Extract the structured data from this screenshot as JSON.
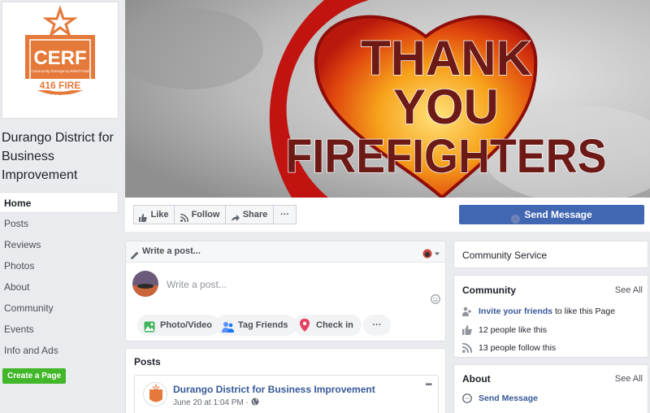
{
  "left": {
    "logo": {
      "top_text": "CERF",
      "sub_text": "Community Emergency Relief Fund",
      "band_text": "416 FIRE",
      "bottom_text": "SW COLORADO"
    },
    "page_name": "Durango District for Business Improvement",
    "nav": [
      {
        "label": "Home",
        "active": true
      },
      {
        "label": "Posts"
      },
      {
        "label": "Reviews"
      },
      {
        "label": "Photos"
      },
      {
        "label": "About"
      },
      {
        "label": "Community"
      },
      {
        "label": "Events"
      },
      {
        "label": "Info and Ads"
      }
    ],
    "create_page": "Create a Page"
  },
  "cover": {
    "line1": "THANK",
    "line2": "YOU",
    "line3": "FIREFIGHTERS"
  },
  "actions": {
    "like": "Like",
    "follow": "Follow",
    "share": "Share",
    "more": "···",
    "send_message": "Send Message"
  },
  "composer": {
    "header": "Write a post...",
    "placeholder": "Write a post...",
    "tools": [
      "Photo/Video",
      "Tag Friends",
      "Check in"
    ],
    "more": "···"
  },
  "posts": {
    "title": "Posts",
    "first": {
      "author": "Durango District for Business Improvement",
      "time": "June 20 at 1:04 PM · ",
      "more": "•••"
    }
  },
  "right": {
    "category": "Community Service",
    "community": {
      "title": "Community",
      "see_all": "See All",
      "invite_link": "Invite your friends",
      "invite_rest": " to like this Page",
      "likes": "12 people like this",
      "follows": "13 people follow this"
    },
    "about": {
      "title": "About",
      "see_all": "See All",
      "send_message": "Send Message"
    }
  },
  "colors": {
    "fb_blue": "#4267b2",
    "link": "#365899",
    "green": "#42b72a",
    "cerf_orange": "#e5793a"
  }
}
